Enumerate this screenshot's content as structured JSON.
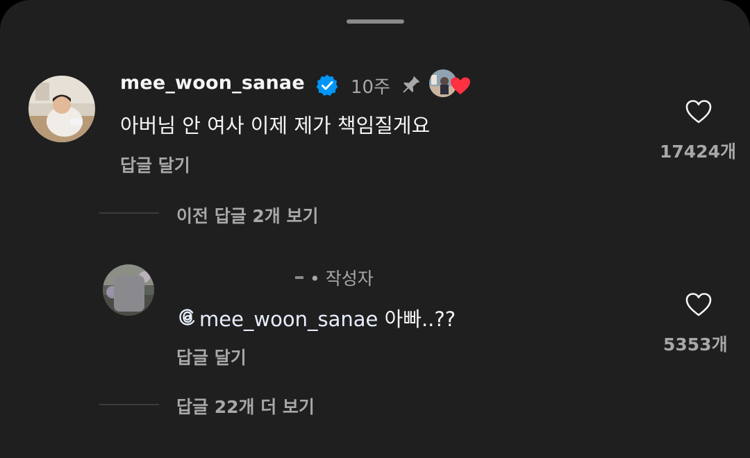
{
  "comment": {
    "username": "mee_woon_sanae",
    "time": "10주",
    "text": "아버님 안 여사 이제 제가 책임질게요",
    "reply_label": "답글 달기",
    "like_count": "17424개",
    "verified": true,
    "pinned": true,
    "liked_by_author": true
  },
  "previous_replies_label": "이전 답글 2개 보기",
  "reply": {
    "author_tag": "• 작성자",
    "mention": "mee_woon_sanae",
    "text": " 아빠..??",
    "reply_label": "답글 달기",
    "like_count": "5353개"
  },
  "more_replies_label": "답글 22개 더 보기",
  "colors": {
    "background": "#1f1f1f",
    "primary_text": "#f5f5f5",
    "secondary_text": "#a8a8a8",
    "verified_blue": "#0095f6",
    "heart_red": "#ff3040"
  }
}
